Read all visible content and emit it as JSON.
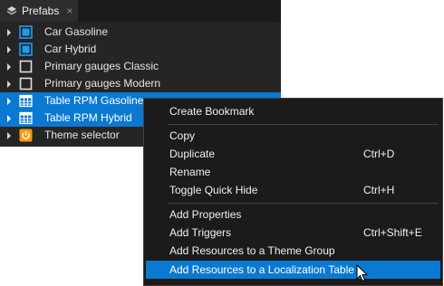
{
  "panel": {
    "tab_label": "Prefabs",
    "tab_close": "×",
    "tab_icon": "layers-icon",
    "items": [
      {
        "label": "Car Gasoline",
        "icon": "screen-icon",
        "selected": false
      },
      {
        "label": "Car Hybrid",
        "icon": "screen-icon",
        "selected": false
      },
      {
        "label": "Primary gauges Classic",
        "icon": "square-icon",
        "selected": false
      },
      {
        "label": "Primary gauges Modern",
        "icon": "square-icon",
        "selected": false
      },
      {
        "label": "Table RPM Gasoline",
        "icon": "table-icon",
        "selected": true
      },
      {
        "label": "Table RPM Hybrid",
        "icon": "table-icon",
        "selected": true
      },
      {
        "label": "Theme selector",
        "icon": "power-icon",
        "selected": false
      }
    ]
  },
  "context_menu": {
    "items": [
      {
        "label": "Create Bookmark",
        "shortcut": ""
      },
      {
        "label": "Copy",
        "shortcut": ""
      },
      {
        "label": "Duplicate",
        "shortcut": "Ctrl+D"
      },
      {
        "label": "Rename",
        "shortcut": ""
      },
      {
        "label": "Toggle Quick Hide",
        "shortcut": "Ctrl+H"
      },
      {
        "label": "Add Properties",
        "shortcut": ""
      },
      {
        "label": "Add Triggers",
        "shortcut": "Ctrl+Shift+E"
      },
      {
        "label": "Add Resources to a Theme Group",
        "shortcut": ""
      },
      {
        "label": "Add Resources to a Localization Table",
        "shortcut": "",
        "highlighted": true
      }
    ]
  },
  "colors": {
    "panel_bg": "#252526",
    "selection": "#0a79d1",
    "menu_bg": "#1b1b1c",
    "power_icon": "#f39c12",
    "screen_icon": "#1e9bf0"
  }
}
